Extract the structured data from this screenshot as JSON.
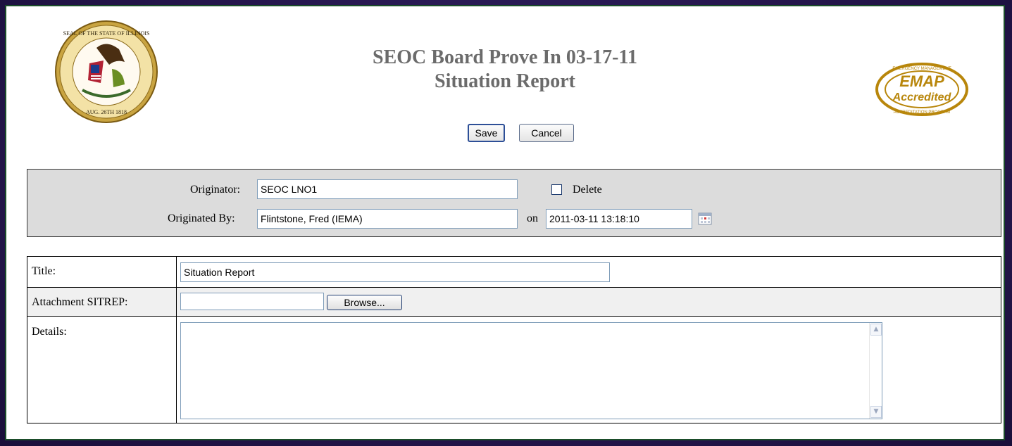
{
  "header": {
    "title_line1": "SEOC Board Prove In 03-17-11",
    "title_line2": "Situation Report",
    "save_label": "Save",
    "cancel_label": "Cancel",
    "seal_text_top": "SEAL OF THE STATE OF ILLINOIS",
    "seal_text_bottom": "AUG. 26TH 1818",
    "emap_text": "EMAP",
    "emap_sub": "Accredited",
    "emap_arc_top": "EMERGENCY MANAGEMENT",
    "emap_arc_bottom": "ACCREDITATION PROGRAM"
  },
  "originator_panel": {
    "originator_label": "Originator:",
    "originator_value": "SEOC LNO1",
    "delete_label": "Delete",
    "delete_checked": false,
    "originated_by_label": "Originated By:",
    "originated_by_value": "Flintstone, Fred (IEMA)",
    "on_label": "on",
    "date_value": "2011-03-11 13:18:10"
  },
  "form": {
    "title_label": "Title:",
    "title_value": "Situation Report",
    "attachment_label": "Attachment SITREP:",
    "attachment_value": "",
    "browse_label": "Browse...",
    "details_label": "Details:",
    "details_value": ""
  },
  "colors": {
    "background": "#26174f",
    "frame_border": "#1b4d2a",
    "panel_gray": "#dcdcdc",
    "title_gray": "#6b6b6b",
    "emap_gold": "#b8860b"
  }
}
